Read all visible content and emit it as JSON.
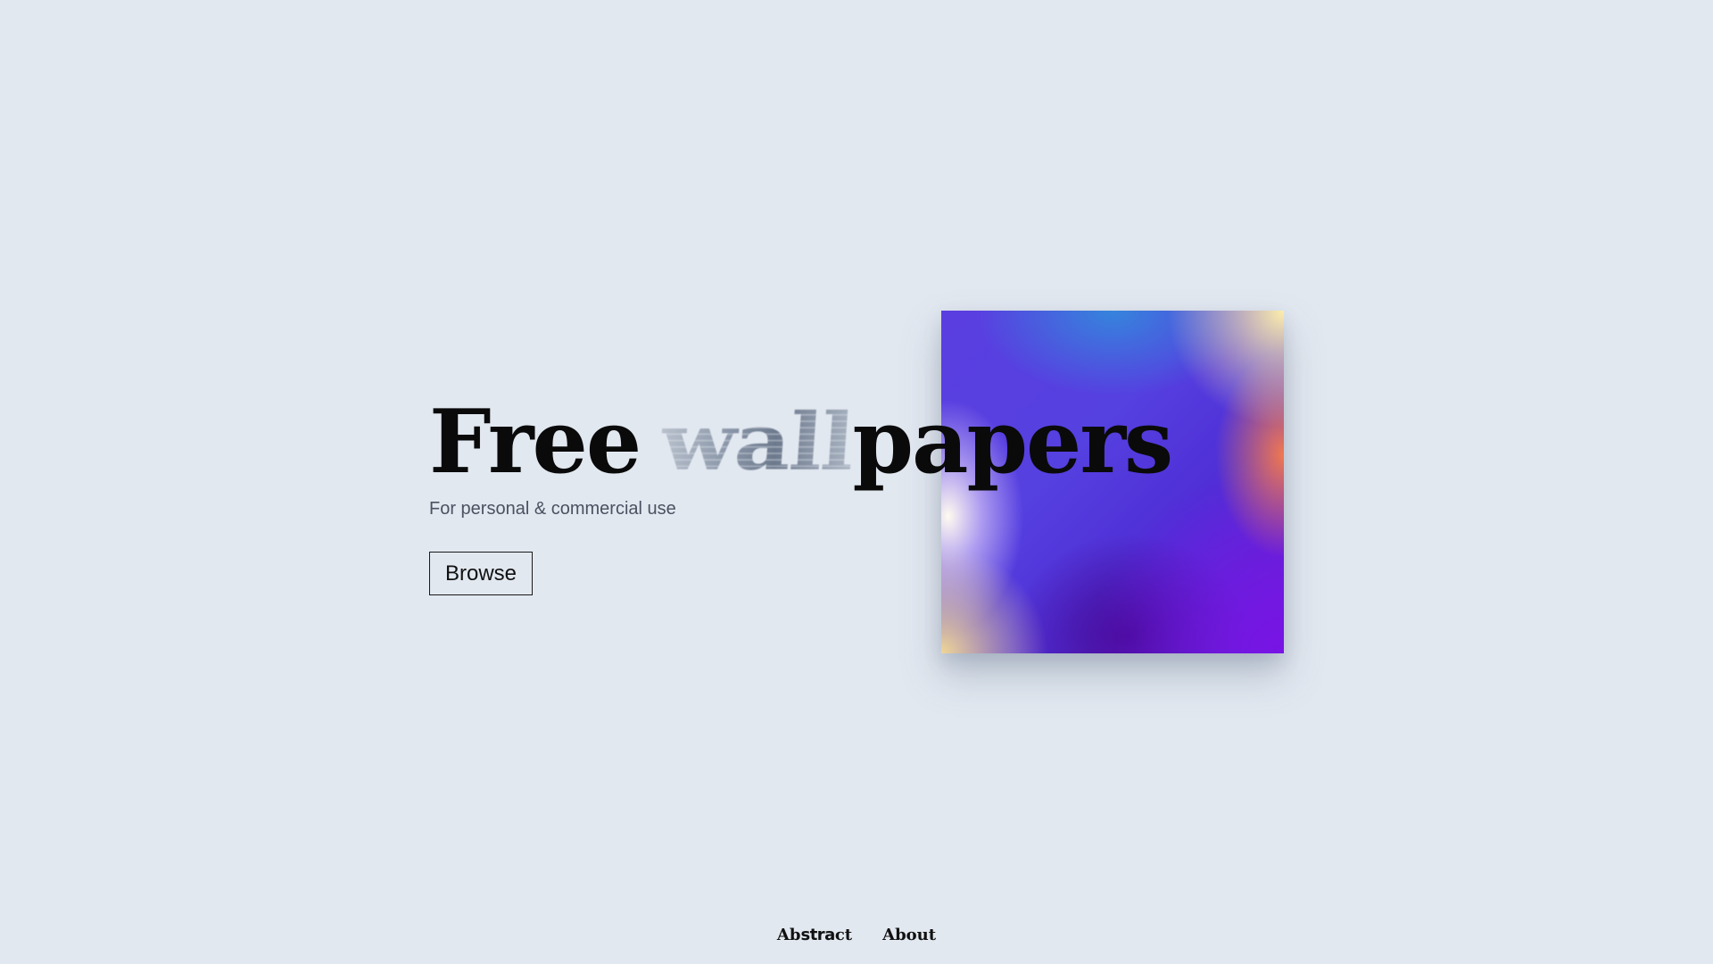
{
  "hero": {
    "title_prefix": "Free",
    "title_glitch": "wall",
    "title_suffix": "papers",
    "subtitle": "For personal & commercial use",
    "browse_label": "Browse"
  },
  "preview": {
    "colors": [
      "#5a3ee0",
      "#328cdc",
      "#fdeeaa",
      "#f07850",
      "#7814e6",
      "#460a96",
      "#f0d696"
    ]
  },
  "footer": {
    "abstract_part1": "Ab",
    "abstract_part2": "stra",
    "abstract_part3": "ct",
    "about_label": "About"
  }
}
